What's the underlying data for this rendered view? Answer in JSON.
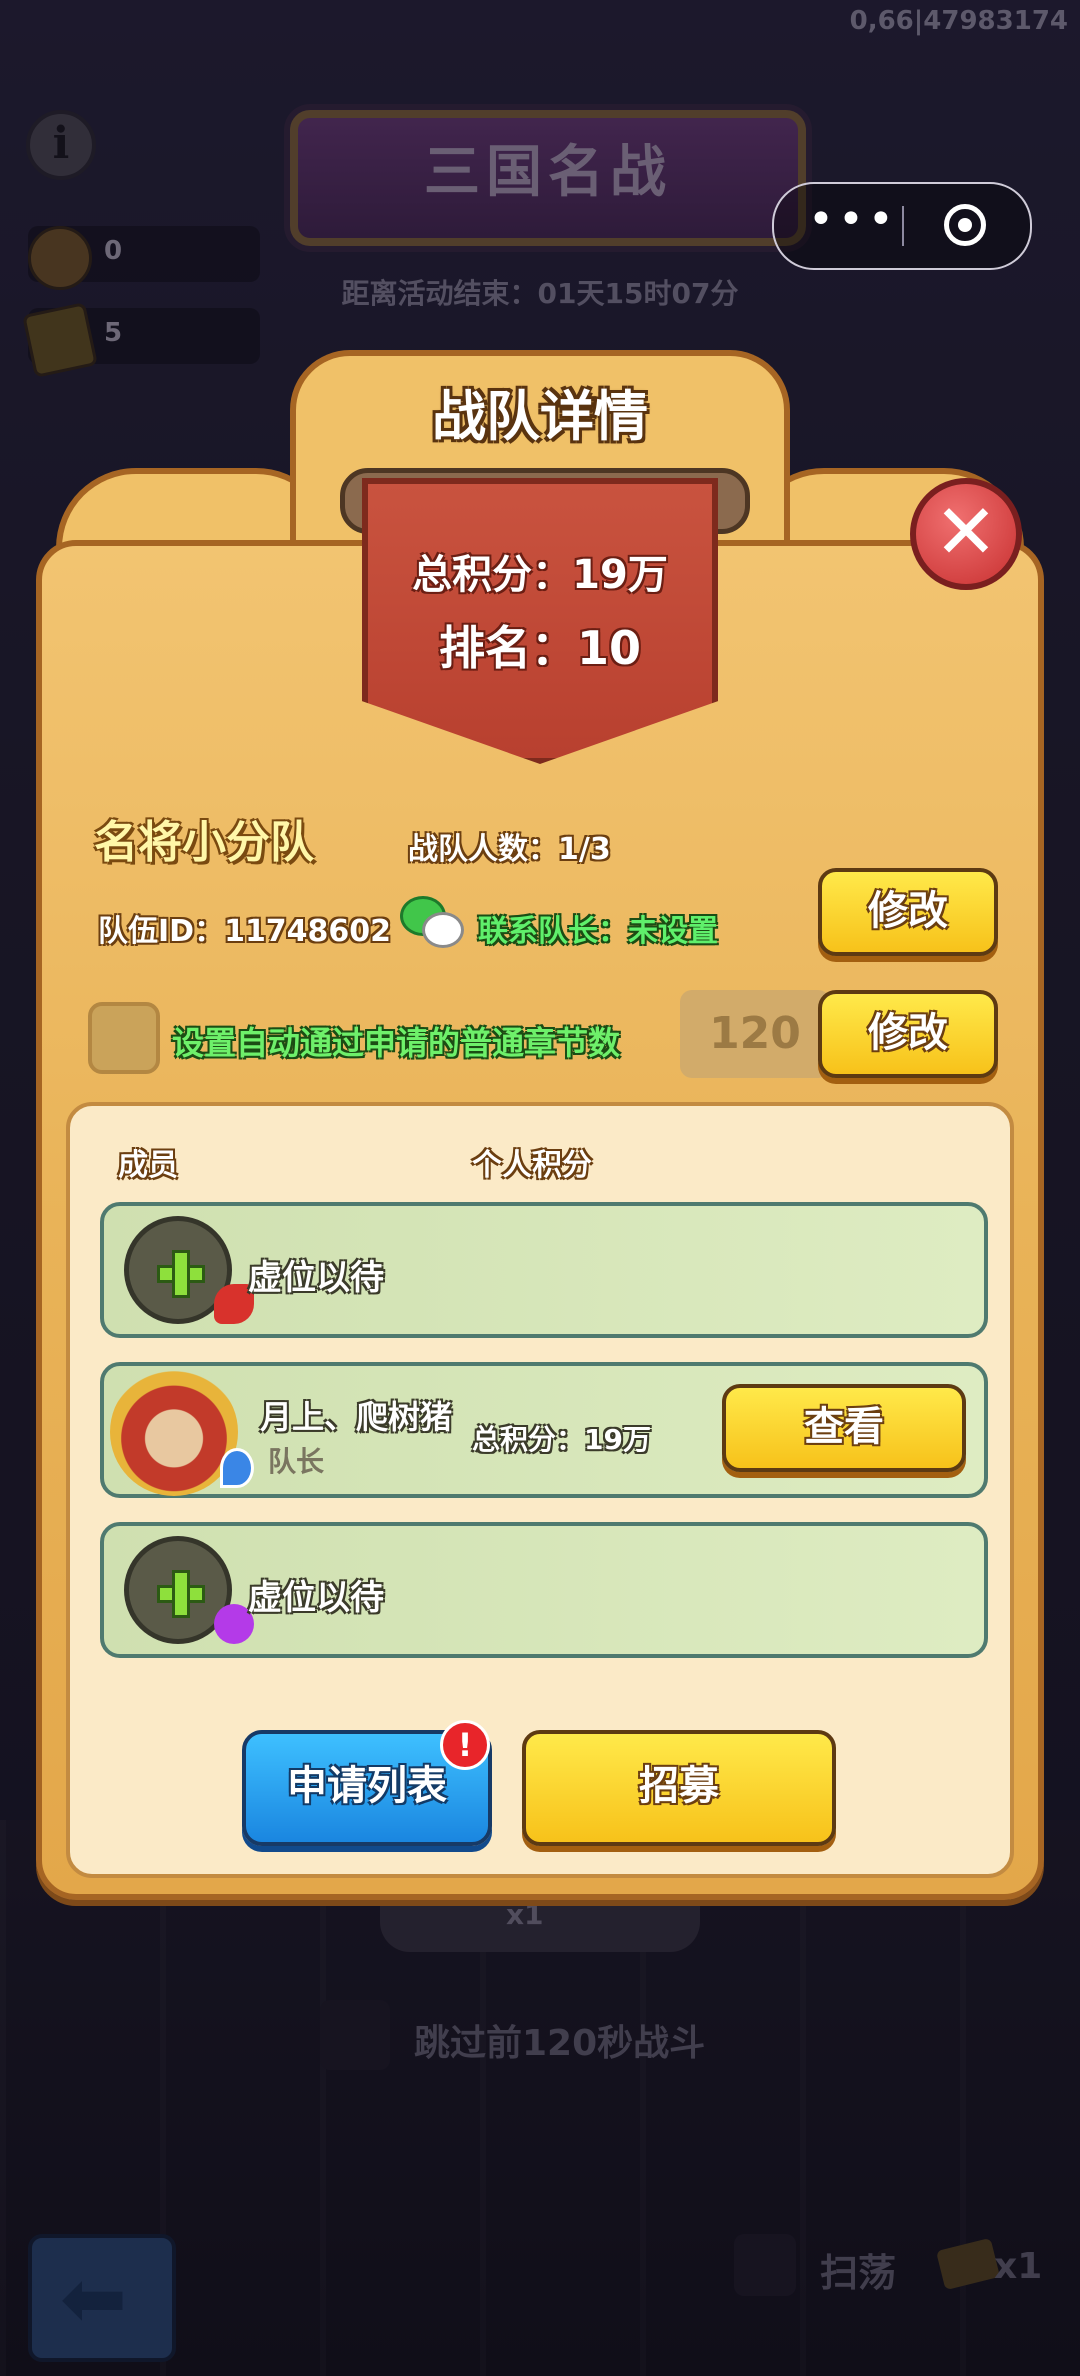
{
  "status": {
    "debug_id": "0,66|47983174"
  },
  "resources": [
    {
      "icon": "coin-pouch-icon",
      "value": "0"
    },
    {
      "icon": "ticket-icon",
      "value": "5"
    }
  ],
  "event": {
    "title": "三国名战",
    "countdown": "距离活动结束：01天15时07分"
  },
  "capsule": {
    "menu": "•••"
  },
  "modal": {
    "title": "战队详情",
    "total_score": "总积分：19万",
    "rank": "排名：10",
    "close": "✕",
    "team_name": "名将小分队",
    "member_count": "战队人数：1/3",
    "team_id": "队伍ID：11748602",
    "contact": "联系队长：未设置",
    "edit_label": "修改",
    "auto_approve_label": "设置自动通过申请的普通章节数",
    "auto_approve_value": "120",
    "columns": {
      "member": "成员",
      "score": "个人积分"
    },
    "members": [
      {
        "label": "虚位以待"
      },
      {
        "name": "月上、爬树猪",
        "role": "队长",
        "score": "总积分：19万",
        "action": "查看"
      },
      {
        "label": "虚位以待"
      }
    ],
    "apply_list": "申请列表",
    "notice_badge": "!",
    "recruit": "招募"
  },
  "background": {
    "chip_count": "x1",
    "skip_label": "跳过前120秒战斗",
    "sweep_label": "扫荡",
    "sweep_count": "x1"
  },
  "colors": {
    "modal": "#e9b358",
    "yellow_button": "#f7c21a",
    "blue_button": "#1a86e0",
    "green_text": "#5ff06b",
    "banner": "#c9533f"
  }
}
